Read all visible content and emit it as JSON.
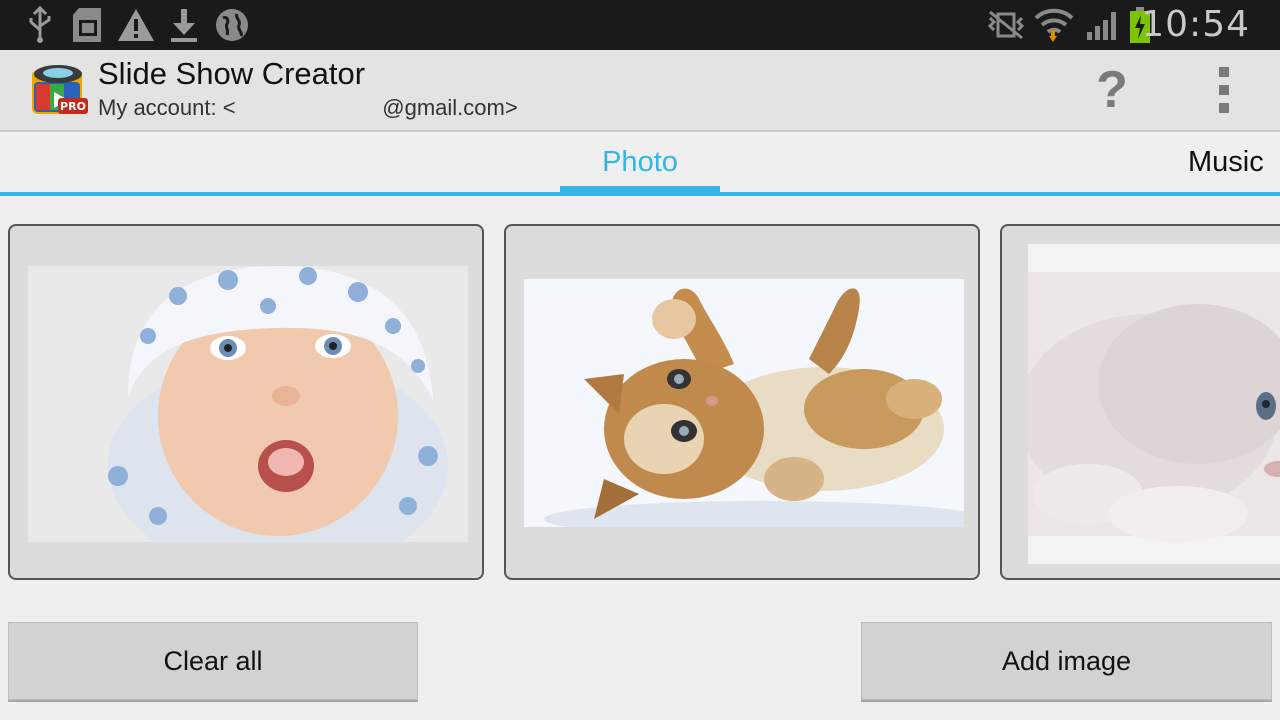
{
  "status_bar": {
    "icons": [
      "usb-icon",
      "sd-card-icon",
      "warning-icon",
      "download-icon",
      "globe-icon",
      "no-vibration-icon",
      "wifi-icon",
      "signal-icon",
      "battery-charging-icon"
    ],
    "time": "10:54"
  },
  "action_bar": {
    "title": "Slide Show Creator",
    "subtitle": "My account: <                        @gmail.com>",
    "help_label": "?",
    "icon_badge": "PRO"
  },
  "tabs": [
    {
      "label": "Photo",
      "selected": true
    },
    {
      "label": "Music",
      "selected": false
    }
  ],
  "colors": {
    "accent": "#33b5e5",
    "status_bar": "#1a1a1a",
    "action_bar": "#e3e3e3"
  },
  "photos": [
    {
      "subject": "baby-in-hat"
    },
    {
      "subject": "kitten-on-back"
    },
    {
      "subject": "white-kitten"
    }
  ],
  "buttons": {
    "clear_all": "Clear all",
    "add_image": "Add image"
  }
}
